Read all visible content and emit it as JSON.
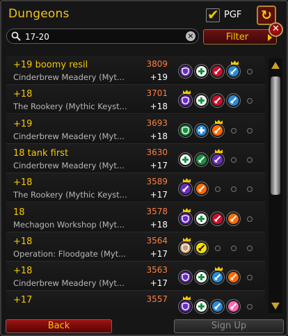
{
  "window": {
    "title": "Dungeons"
  },
  "pgf": {
    "label": "PGF",
    "checked": true
  },
  "search": {
    "value": "17-20",
    "placeholder": ""
  },
  "toolbar": {
    "filter_label": "Filter"
  },
  "footer": {
    "back_label": "Back",
    "signup_label": "Sign Up"
  },
  "colors": {
    "gold": "#f5c800",
    "score": "#ff7f3f",
    "tank": "#1a8f3e",
    "healer": "#ffffff",
    "dps_red": "#c8102e",
    "dps_blue": "#2b8cd6"
  },
  "rows": [
    {
      "name": "+19 boomy resil",
      "dungeon": "Cinderbrew Meadery (Myt...",
      "score": "3809",
      "level": "+19",
      "roles": [
        {
          "c": "#6a2dbd",
          "icon": "shield-icon"
        },
        {
          "c": "#ffffff",
          "icon": "healer-cross-icon"
        },
        {
          "c": "#c8102e",
          "icon": "sword-icon"
        },
        {
          "c": "#2b8cd6",
          "icon": "sword-icon",
          "crown": true
        },
        {
          "empty": true
        }
      ]
    },
    {
      "name": "+18",
      "dungeon": "The Rookery (Mythic Keyst...",
      "score": "3701",
      "level": "+18",
      "roles": [
        {
          "c": "#6a2dbd",
          "icon": "shield-icon",
          "crown": true
        },
        {
          "c": "#ffffff",
          "icon": "healer-cross-icon"
        },
        {
          "c": "#c8102e",
          "icon": "sword-icon"
        },
        {
          "c": "#2b8cd6",
          "icon": "sword-icon"
        },
        {
          "empty": true
        }
      ]
    },
    {
      "name": "+19",
      "dungeon": "Cinderbrew Meadery (Myt...",
      "score": "3693",
      "level": "+18",
      "roles": [
        {
          "c": "#1a8f3e",
          "icon": "shield-icon"
        },
        {
          "c": "#2b8cd6",
          "icon": "healer-cross-icon"
        },
        {
          "c": "#ff6a00",
          "icon": "sword-icon",
          "crown": true
        },
        {
          "empty": true
        },
        {
          "empty": true
        }
      ]
    },
    {
      "name": "18 tank first",
      "dungeon": "Cinderbrew Meadery (Myt...",
      "score": "3630",
      "level": "+17",
      "roles": [
        {
          "c": "#ffffff",
          "icon": "healer-cross-icon"
        },
        {
          "c": "#1a8f3e",
          "icon": "sword-icon"
        },
        {
          "c": "#6a2dbd",
          "icon": "sword-icon",
          "crown": true
        },
        {
          "empty": true
        },
        {
          "empty": true
        }
      ]
    },
    {
      "name": "+18",
      "dungeon": "The Rookery (Mythic Keyst...",
      "score": "3589",
      "level": "+17",
      "roles": [
        {
          "c": "#6a2dbd",
          "icon": "sword-icon",
          "crown": true
        },
        {
          "c": "#ff6a00",
          "icon": "sword-icon"
        },
        {
          "empty": true
        },
        {
          "empty": true
        },
        {
          "empty": true
        }
      ]
    },
    {
      "name": "18",
      "dungeon": "Mechagon Workshop (Myt...",
      "score": "3578",
      "level": "+18",
      "roles": [
        {
          "c": "#6a2dbd",
          "icon": "shield-icon",
          "crown": true
        },
        {
          "c": "#ffffff",
          "icon": "healer-cross-icon"
        },
        {
          "c": "#c8102e",
          "icon": "sword-icon"
        },
        {
          "c": "#ff6a00",
          "icon": "sword-icon"
        },
        {
          "empty": true
        }
      ]
    },
    {
      "name": "+18",
      "dungeon": "Operation: Floodgate (Myt...",
      "score": "3564",
      "level": "+17",
      "roles": [
        {
          "c": "#c79c6e",
          "icon": "shield-icon",
          "crown": true
        },
        {
          "c": "#f5e000",
          "icon": "sword-icon"
        },
        {
          "empty": true
        },
        {
          "empty": true
        },
        {
          "empty": true
        }
      ]
    },
    {
      "name": "+18",
      "dungeon": "Cinderbrew Meadery (Myt...",
      "score": "3563",
      "level": "+17",
      "roles": [
        {
          "c": "#6a2dbd",
          "icon": "shield-icon"
        },
        {
          "c": "#ffffff",
          "icon": "healer-cross-icon"
        },
        {
          "c": "#2b8cd6",
          "icon": "sword-icon",
          "crown": true
        },
        {
          "c": "#ff6a00",
          "icon": "sword-icon"
        },
        {
          "empty": true
        }
      ]
    },
    {
      "name": "+17",
      "dungeon": "",
      "score": "3557",
      "level": "",
      "roles": [
        {
          "c": "#6a2dbd",
          "icon": "shield-icon",
          "crown": true
        },
        {
          "c": "#ffffff",
          "icon": "healer-cross-icon"
        },
        {
          "c": "#2b8cd6",
          "icon": "sword-icon"
        },
        {
          "c": "#ff69b4",
          "icon": "sword-icon"
        },
        {
          "empty": true
        }
      ]
    }
  ]
}
